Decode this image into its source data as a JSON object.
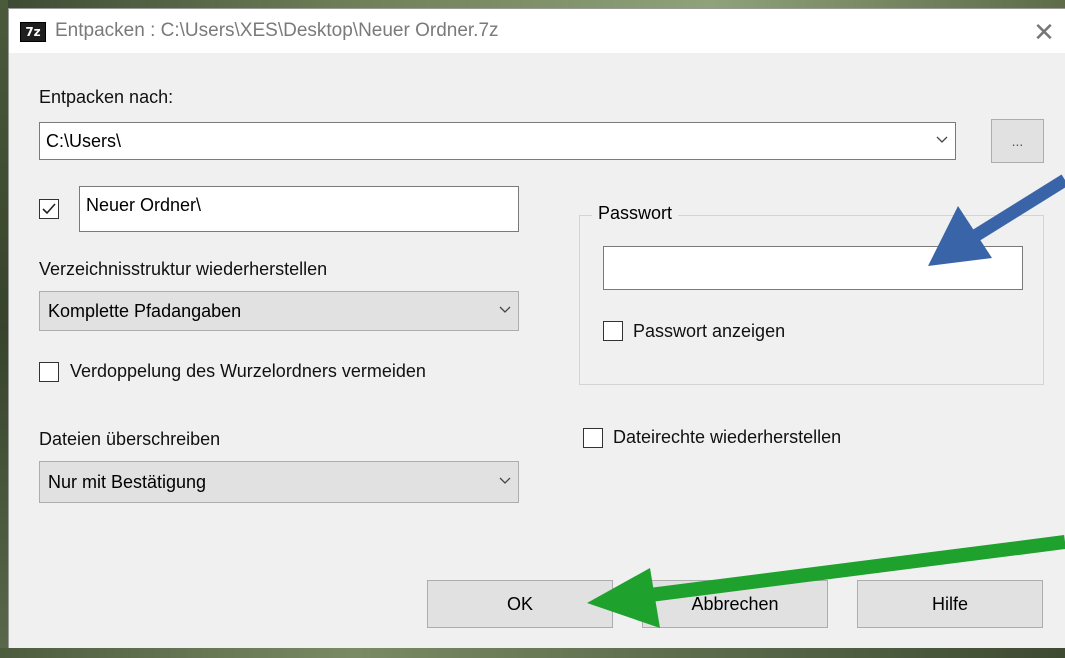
{
  "window": {
    "icon_text": "7z",
    "title": "Entpacken : C:\\Users\\XES\\Desktop\\Neuer Ordner.7z",
    "close_glyph": "✕"
  },
  "extract_to": {
    "label": "Entpacken nach:",
    "value": "C:\\Users\\",
    "browse_label": "..."
  },
  "subfolder": {
    "checked": true,
    "value": "Neuer Ordner\\"
  },
  "path_structure": {
    "label": "Verzeichnisstruktur wiederherstellen",
    "selected": "Komplette Pfadangaben"
  },
  "avoid_duplicate_root": {
    "label": "Verdoppelung des Wurzelordners vermeiden",
    "checked": false
  },
  "overwrite": {
    "label": "Dateien überschreiben",
    "selected": "Nur mit Bestätigung"
  },
  "password": {
    "group_label": "Passwort",
    "value": "",
    "show_label": "Passwort anzeigen",
    "show_checked": false
  },
  "restore_permissions": {
    "label": "Dateirechte wiederherstellen",
    "checked": false
  },
  "buttons": {
    "ok": "OK",
    "cancel": "Abbrechen",
    "help": "Hilfe"
  },
  "annotations": {
    "blue_arrow_color": "#3a64a8",
    "green_arrow_color": "#1fa12e"
  }
}
